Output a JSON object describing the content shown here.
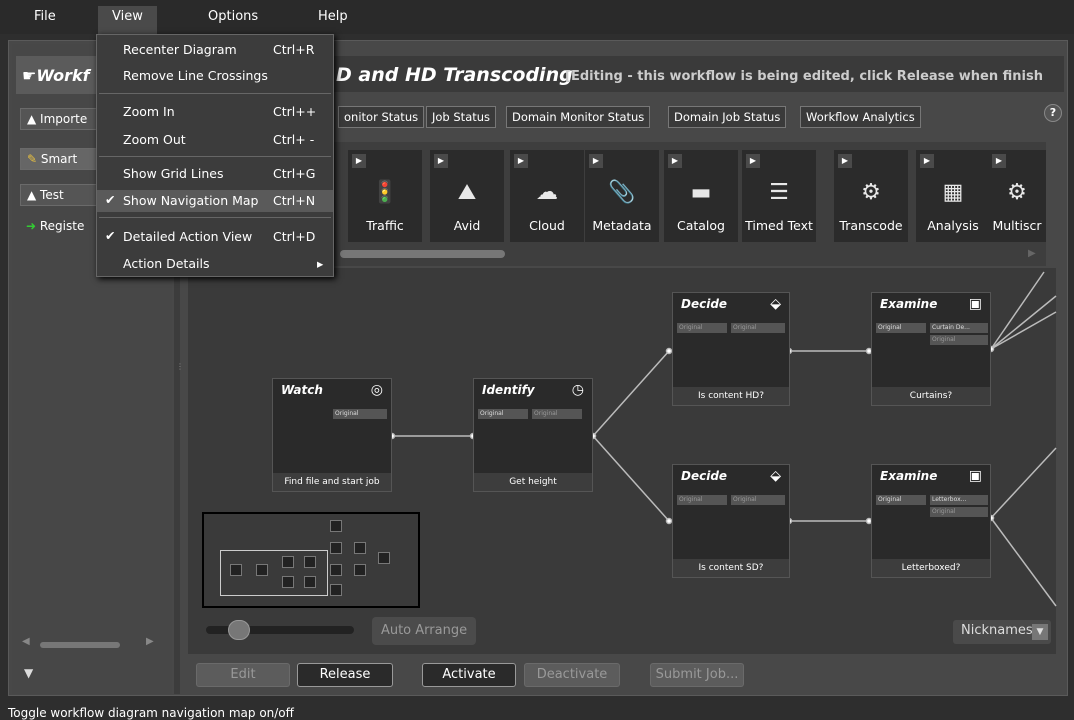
{
  "menubar": {
    "file": "File",
    "view": "View",
    "options": "Options",
    "help": "Help"
  },
  "view_menu": {
    "items": [
      {
        "label": "Recenter Diagram",
        "shortcut": "Ctrl+R"
      },
      {
        "label": "Remove Line Crossings",
        "shortcut": ""
      },
      {
        "label": "Zoom In",
        "shortcut": "Ctrl++"
      },
      {
        "label": "Zoom Out",
        "shortcut": "Ctrl+ -"
      },
      {
        "label": "Show Grid Lines",
        "shortcut": "Ctrl+G"
      },
      {
        "label": "Show Navigation Map",
        "shortcut": "Ctrl+N"
      },
      {
        "label": "Detailed Action View",
        "shortcut": "Ctrl+D"
      },
      {
        "label": "Action Details",
        "shortcut": ""
      }
    ],
    "arrow": "▸"
  },
  "left": {
    "title": "Workf",
    "imported": "Importe",
    "smart": "Smart",
    "test": "Test",
    "registe": "Registe"
  },
  "workflow": {
    "title": "D and HD Transcoding",
    "status": "[Editing - this workflow is being edited, click Release when finish"
  },
  "tabs": [
    "onitor Status",
    "Job Status",
    "Domain Monitor Status",
    "Domain Job Status",
    "Workflow Analytics"
  ],
  "help_label": "?",
  "palette": [
    "Traffic",
    "Avid",
    "Cloud",
    "Metadata",
    "Catalog",
    "Timed Text",
    "Transcode",
    "Analysis",
    "Multiscr"
  ],
  "nodes": {
    "watch": {
      "title": "Watch",
      "chip": "Original",
      "caption": "Find file and start job"
    },
    "identify": {
      "title": "Identify",
      "chip1": "Original",
      "chip2": "Original",
      "caption": "Get height"
    },
    "decide1": {
      "title": "Decide",
      "chip1": "Original",
      "chip2": "Original",
      "caption": "Is content HD?"
    },
    "decide2": {
      "title": "Decide",
      "chip1": "Original",
      "chip2": "Original",
      "caption": "Is content SD?"
    },
    "examine1": {
      "title": "Examine",
      "chip1": "Original",
      "chip2": "Curtain De...",
      "chip3": "Original",
      "caption": "Curtains?"
    },
    "examine2": {
      "title": "Examine",
      "chip1": "Original",
      "chip2": "Letterbox...",
      "chip3": "Original",
      "caption": "Letterboxed?"
    }
  },
  "controls": {
    "auto_arrange": "Auto Arrange",
    "nicknames": "Nicknames"
  },
  "buttons": {
    "edit": "Edit",
    "release": "Release",
    "activate": "Activate",
    "deactivate": "Deactivate",
    "submit": "Submit Job..."
  },
  "status_bar": "Toggle workflow diagram navigation map on/off"
}
